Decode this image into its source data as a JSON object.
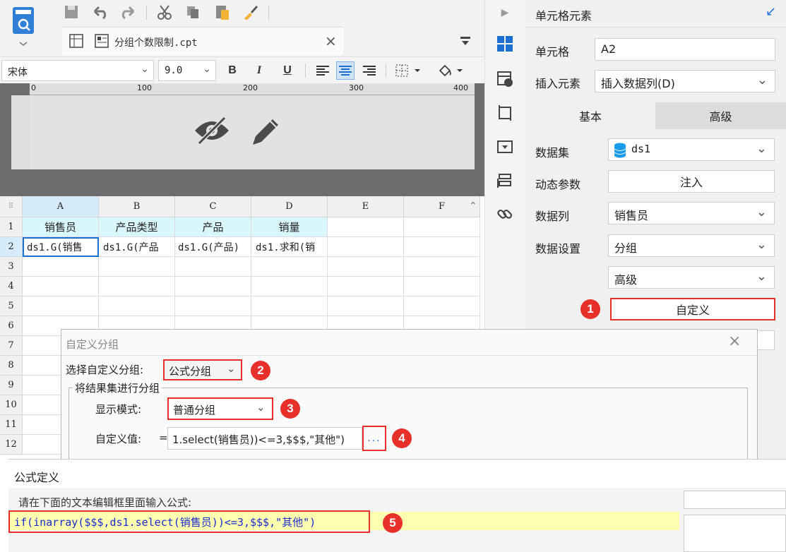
{
  "tab": {
    "title": "分组个数限制.cpt"
  },
  "fontbar": {
    "font": "宋体",
    "size": "9.0",
    "bold": "B",
    "italic": "I",
    "underline": "U"
  },
  "ruler": {
    "ticks": [
      "0",
      "100",
      "200",
      "300",
      "400"
    ]
  },
  "grid": {
    "columns": [
      "A",
      "B",
      "C",
      "D",
      "E",
      "F"
    ],
    "rows": [
      "1",
      "2",
      "3",
      "4",
      "5",
      "6",
      "7",
      "8",
      "9",
      "10",
      "11",
      "12"
    ],
    "row1": [
      "销售员",
      "产品类型",
      "产品",
      "销量"
    ],
    "row2": [
      "ds1.G(销售",
      "ds1.G(产品",
      "ds1.G(产品)",
      "ds1.求和(销"
    ]
  },
  "panel": {
    "title": "单元格元素",
    "cell_label": "单元格",
    "cell_value": "A2",
    "insert_label": "插入元素",
    "insert_value": "插入数据列(D)",
    "tab_basic": "基本",
    "tab_advanced": "高级",
    "dataset_label": "数据集",
    "dataset_value": "ds1",
    "param_label": "动态参数",
    "param_button": "注入",
    "column_label": "数据列",
    "column_value": "销售员",
    "setting_label": "数据设置",
    "setting_value": "分组",
    "advanced_value": "高级",
    "custom_button": "自定义"
  },
  "dialog1": {
    "title": "自定义分组",
    "select_label": "选择自定义分组:",
    "select_value": "公式分组",
    "group_title": "将结果集进行分组",
    "mode_label": "显示模式:",
    "mode_value": "普通分组",
    "custom_label": "自定义值:",
    "equals": "=",
    "custom_value": "1.select(销售员))<=3,$$$,\"其他\")",
    "ellipsis": "..."
  },
  "dialog2": {
    "title": "公式定义",
    "prompt": "请在下面的文本编辑框里面输入公式:",
    "formula": "if(inarray($$$,ds1.select(销售员))<=3,$$$,\"其他\")"
  },
  "badges": [
    "1",
    "2",
    "3",
    "4",
    "5"
  ],
  "colors": {
    "accent": "#1a6fd1",
    "highlight_red": "#e7302a",
    "selected_col": "#d6ecfa",
    "header_cyan": "#d8f6fb",
    "formula_bg": "#ffffb0"
  }
}
